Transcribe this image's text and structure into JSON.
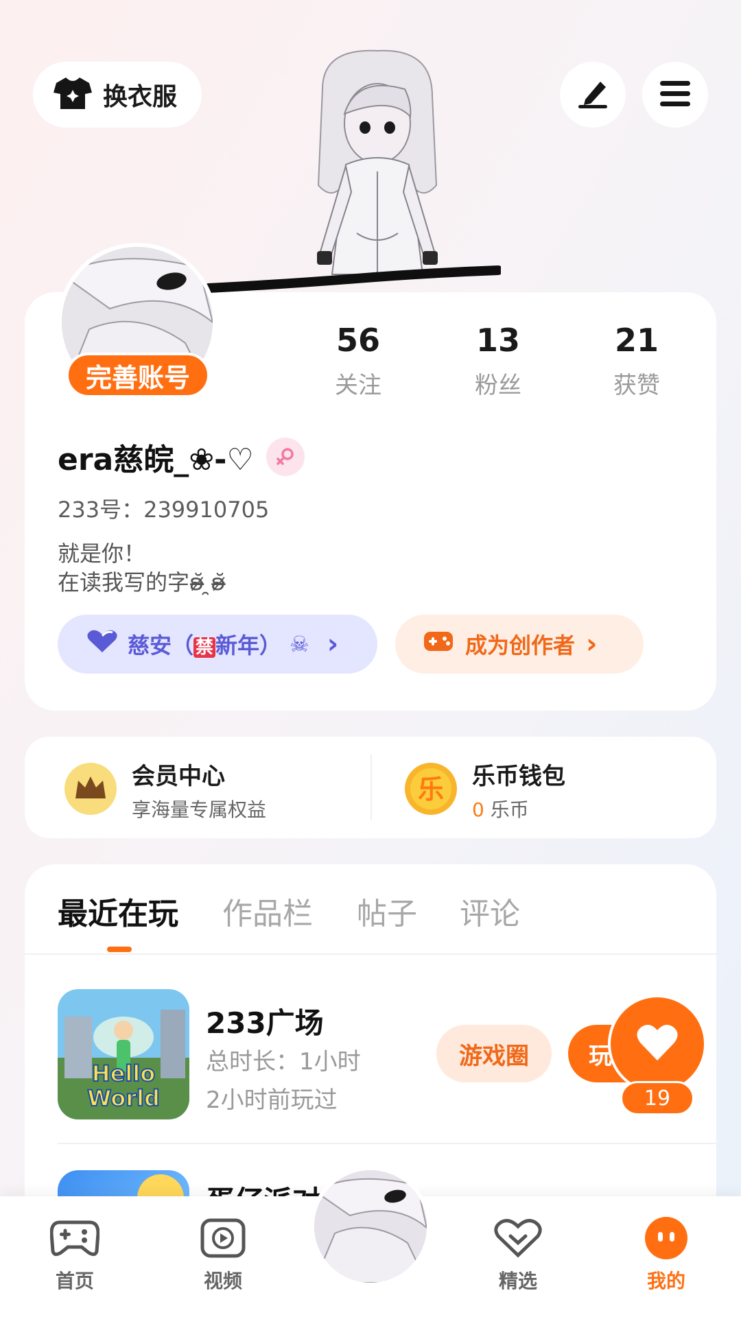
{
  "header": {
    "outfit_label": "换衣服",
    "icons": {
      "outfit": "tshirt-icon",
      "edit": "pen-icon",
      "menu": "hamburger-menu-icon"
    }
  },
  "profile": {
    "complete_badge": "完善账号",
    "stats": [
      {
        "value": "56",
        "label": "关注"
      },
      {
        "value": "13",
        "label": "粉丝"
      },
      {
        "value": "21",
        "label": "获赞"
      }
    ],
    "nickname": "era慈皖_❀-♡",
    "gender_icon": "female-icon",
    "uid": "233号：239910705",
    "bio_line1": "就是你！",
    "bio_line2": "在读我写的字ʚ̴̶̷̆ ̯ʚ̴̶̷̆",
    "guild_tag": {
      "name_part1": "慈安（",
      "ban_char": "禁",
      "name_part2": "新年）",
      "end_glyph": "☠",
      "arrow": "›"
    },
    "creator_tag": {
      "label": "成为创作者",
      "arrow": "›"
    }
  },
  "quick": {
    "member_title": "会员中心",
    "member_sub": "享海量专属权益",
    "wallet_title": "乐币钱包",
    "wallet_amount": "0",
    "wallet_unit": " 乐币",
    "coin_glyph": "乐"
  },
  "tabs": [
    "最近在玩",
    "作品栏",
    "帖子",
    "评论"
  ],
  "games": [
    {
      "name": "233广场",
      "total_time": "总时长：1小时",
      "last_played": "2小时前玩过",
      "circle_label": "游戏圈",
      "play_label": "玩",
      "cover_text_1": "Hello",
      "cover_text_2": "World"
    },
    {
      "name": "蛋仔派对"
    }
  ],
  "like_fab": {
    "count": "19"
  },
  "bottom_nav": [
    {
      "label": "首页"
    },
    {
      "label": "视频"
    },
    {
      "label": "精选"
    },
    {
      "label": "我的"
    }
  ],
  "colors": {
    "accent": "#ff6f12",
    "guild": "#5a5ad6",
    "gold": "#f6c745"
  }
}
